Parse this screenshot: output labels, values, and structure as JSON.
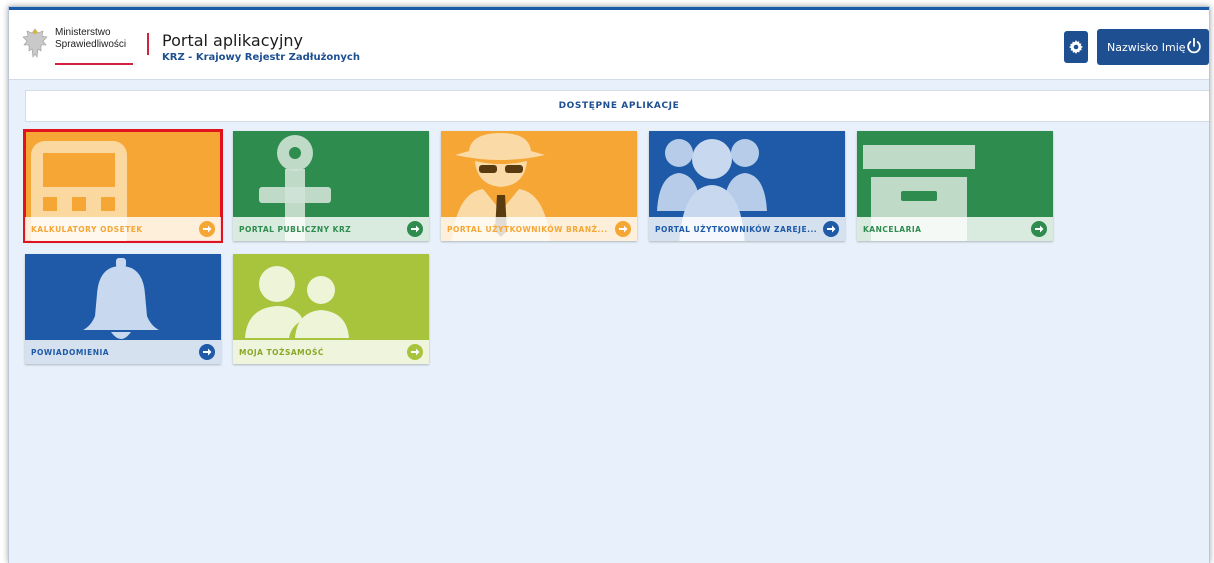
{
  "header": {
    "ministry_line1": "Ministerstwo",
    "ministry_line2": "Sprawiedliwości",
    "title": "Portal aplikacyjny",
    "subtitle": "KRZ - Krajowy Rejestr Zadłużonych",
    "user_label": "Nazwisko Imię",
    "settings_icon": "gear-icon",
    "logout_icon": "power-icon"
  },
  "section": {
    "title": "DOSTĘPNE APLIKACJE"
  },
  "tiles": [
    {
      "label": "KALKULATORY ODSETEK",
      "color": "#f5a634",
      "icon": "calculator-icon",
      "selected": true
    },
    {
      "label": "PORTAL PUBLICZNY KRZ",
      "color": "#2d8c4e",
      "icon": "anchor-icon",
      "selected": false
    },
    {
      "label": "PORTAL UŻYTKOWNIKÓW BRANŻ...",
      "color": "#f5a634",
      "icon": "spy-icon",
      "selected": false
    },
    {
      "label": "PORTAL UŻYTKOWNIKÓW ZAREJE...",
      "color": "#1e5aa8",
      "icon": "users-group-icon",
      "selected": false
    },
    {
      "label": "KANCELARIA",
      "color": "#2d8c4e",
      "icon": "archive-box-icon",
      "selected": false
    },
    {
      "label": "POWIADOMIENIA",
      "color": "#1e5aa8",
      "icon": "bell-icon",
      "selected": false
    },
    {
      "label": "MOJA TOŻSAMOŚĆ",
      "color": "#a8c43c",
      "icon": "identity-icon",
      "selected": false
    }
  ],
  "colors": {
    "brand_blue": "#1d4f91",
    "accent_red": "#d4213d",
    "selection_red": "#e0141e",
    "background": "#e8f1fb"
  }
}
